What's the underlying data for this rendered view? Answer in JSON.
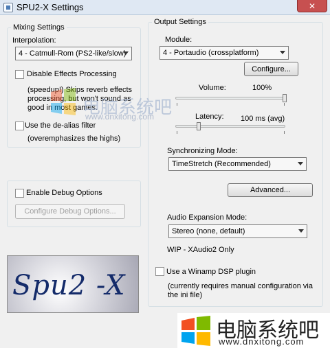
{
  "window": {
    "title": "SPU2-X Settings",
    "close_glyph": "✕"
  },
  "mixing": {
    "group_label": "Mixing Settings",
    "interpolation_label": "Interpolation:",
    "interpolation_value": "4 - Catmull-Rom (PS2-like/slow)",
    "disable_effects_label": "Disable Effects Processing",
    "disable_effects_checked": false,
    "effects_desc_1": "(speedup!) Skips reverb effects",
    "effects_desc_2": "processing, but won't sound as",
    "effects_desc_3": "good in most games.",
    "dealias_label": "Use the de-alias filter",
    "dealias_checked": false,
    "dealias_desc": "(overemphasizes the highs)"
  },
  "debug": {
    "enable_label": "Enable Debug Options",
    "enable_checked": false,
    "configure_label": "Configure Debug Options..."
  },
  "logo": {
    "text": "Spu2 -X"
  },
  "output": {
    "group_label": "Output Settings",
    "module_label": "Module:",
    "module_value": "4 - Portaudio (crossplatform)",
    "configure_label": "Configure...",
    "volume_label": "Volume:",
    "volume_value": "100%",
    "volume_level": 1.0,
    "latency_label": "Latency:",
    "latency_value": "100 ms (avg)",
    "latency_level": 0.22,
    "sync_label": "Synchronizing Mode:",
    "sync_value": "TimeStretch (Recommended)",
    "advanced_label": "Advanced...",
    "expansion_label": "Audio Expansion Mode:",
    "expansion_value": "Stereo (none, default)",
    "wip_text": "WIP - XAudio2 Only",
    "winamp_label": "Use a Winamp DSP plugin",
    "winamp_checked": false,
    "winamp_desc_1": "(currently requires manual configuration via",
    "winamp_desc_2": "the ini file)"
  },
  "watermark": {
    "text_cn": "电脑系统吧",
    "url": "www.dnxitong.com",
    "colors": [
      "#f25022",
      "#7fba00",
      "#00a4ef",
      "#ffb900"
    ]
  }
}
